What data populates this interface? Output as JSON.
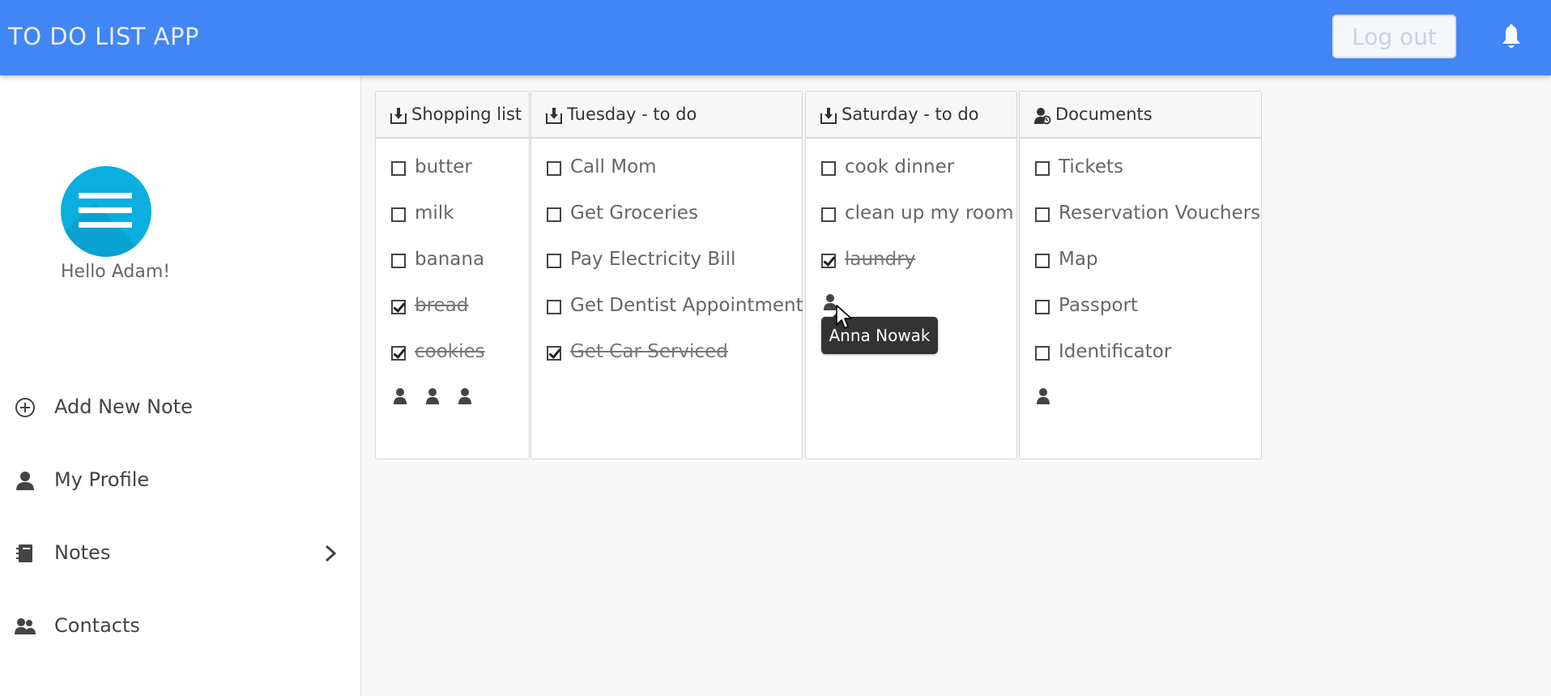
{
  "app": {
    "title": "TO DO LIST APP",
    "logout_label": "Log out"
  },
  "colors": {
    "header": "#4285f4",
    "avatar": "#0aafe0",
    "sidebar_bg": "#ffffff",
    "page_bg": "#f7f7f7"
  },
  "sidebar": {
    "greeting": "Hello Adam!",
    "items": [
      {
        "label": "Add New Note",
        "icon": "plus-circle-icon"
      },
      {
        "label": "My Profile",
        "icon": "user-icon"
      },
      {
        "label": "Notes",
        "icon": "notebook-icon"
      },
      {
        "label": "Contacts",
        "icon": "contacts-icon"
      }
    ]
  },
  "notes": [
    {
      "title": "Shopping list",
      "icon": "download-box-icon",
      "items": [
        {
          "label": "butter",
          "checked": false
        },
        {
          "label": "milk",
          "checked": false
        },
        {
          "label": "banana",
          "checked": false
        },
        {
          "label": "bread",
          "checked": true
        },
        {
          "label": "cookies",
          "checked": true
        }
      ],
      "shared_users": 3
    },
    {
      "title": "Tuesday - to do",
      "icon": "download-box-icon",
      "items": [
        {
          "label": "Call Mom",
          "checked": false
        },
        {
          "label": "Get Groceries",
          "checked": false
        },
        {
          "label": "Pay Electricity Bill",
          "checked": false
        },
        {
          "label": "Get Dentist Appointment",
          "checked": false
        },
        {
          "label": "Get Car Serviced",
          "checked": true
        }
      ],
      "shared_users": 0
    },
    {
      "title": "Saturday - to do",
      "icon": "download-box-icon",
      "items": [
        {
          "label": "cook dinner",
          "checked": false
        },
        {
          "label": "clean up my room",
          "checked": false
        },
        {
          "label": "laundry",
          "checked": true
        }
      ],
      "shared_users": 1
    },
    {
      "title": "Documents",
      "icon": "shared-user-icon",
      "items": [
        {
          "label": "Tickets",
          "checked": false
        },
        {
          "label": "Reservation Vouchers",
          "checked": false
        },
        {
          "label": "Map",
          "checked": false
        },
        {
          "label": "Passport",
          "checked": false
        },
        {
          "label": "Identificator",
          "checked": false
        }
      ],
      "shared_users": 1
    }
  ],
  "tooltip": {
    "text": "Anna Nowak"
  }
}
